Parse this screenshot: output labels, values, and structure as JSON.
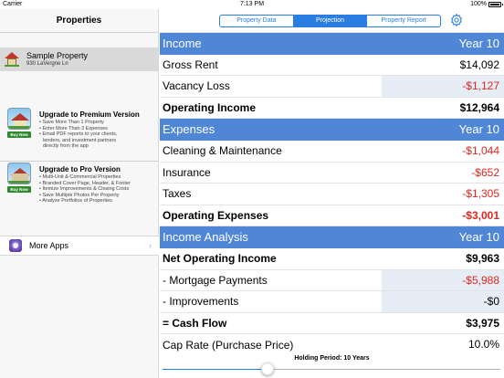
{
  "status_bar": {
    "carrier": "Carrier",
    "time": "7:13 PM",
    "battery": "100%"
  },
  "sidebar": {
    "title": "Properties",
    "property": {
      "name": "Sample Property",
      "address": "930 LaVergne Ln"
    },
    "promos": [
      {
        "title": "Upgrade to Premium Version",
        "button": "Buy Now",
        "bullets": [
          "• Save More Than 1 Property",
          "• Enter More Than 3 Expenses",
          "• Email PDF reports to your clients,",
          "  lenders, and investment partners",
          "  directly from the app"
        ]
      },
      {
        "title": "Upgrade to Pro Version",
        "button": "Buy Now",
        "bullets": [
          "• Multi-Unit & Commercial Properties",
          "• Branded Cover Page, Header, & Footer",
          "• Itemize Improvements & Closing Costs",
          "• Save Multiple Photos Per Property",
          "• Analyze Portfolios of Properties"
        ]
      }
    ],
    "more_apps": "More Apps"
  },
  "tabs": [
    {
      "label": "Property Data",
      "active": false
    },
    {
      "label": "Projection",
      "active": true
    },
    {
      "label": "Property Report",
      "active": false
    }
  ],
  "table": [
    {
      "kind": "section",
      "label": "Income",
      "value": "Year 10"
    },
    {
      "kind": "row",
      "label": "Gross Rent",
      "value": "$14,092",
      "negative": false,
      "bold": false
    },
    {
      "kind": "row",
      "label": "Vacancy Loss",
      "value": "-$1,127",
      "negative": true,
      "bold": false,
      "shaded": true
    },
    {
      "kind": "row",
      "label": "Operating Income",
      "value": "$12,964",
      "negative": false,
      "bold": true
    },
    {
      "kind": "section",
      "label": "Expenses",
      "value": "Year 10"
    },
    {
      "kind": "row",
      "label": "Cleaning & Maintenance",
      "value": "-$1,044",
      "negative": true,
      "bold": false
    },
    {
      "kind": "row",
      "label": "Insurance",
      "value": "-$652",
      "negative": true,
      "bold": false
    },
    {
      "kind": "row",
      "label": "Taxes",
      "value": "-$1,305",
      "negative": true,
      "bold": false
    },
    {
      "kind": "row",
      "label": "Operating Expenses",
      "value": "-$3,001",
      "negative": true,
      "bold": true
    },
    {
      "kind": "section",
      "label": "Income Analysis",
      "value": "Year 10"
    },
    {
      "kind": "row",
      "label": "Net Operating Income",
      "value": "$9,963",
      "negative": false,
      "bold": true
    },
    {
      "kind": "row",
      "label": "- Mortgage Payments",
      "value": "-$5,988",
      "negative": true,
      "bold": false,
      "shaded": true
    },
    {
      "kind": "row",
      "label": "- Improvements",
      "value": "-$0",
      "negative": false,
      "bold": false,
      "shaded": true
    },
    {
      "kind": "row",
      "label": "= Cash Flow",
      "value": "$3,975",
      "negative": false,
      "bold": true
    },
    {
      "kind": "row",
      "label": "Cap Rate (Purchase Price)",
      "value": "10.0%",
      "negative": false,
      "bold": false
    }
  ],
  "holding_period": {
    "label": "Holding Period: 10 Years",
    "slider_fraction": 0.31
  },
  "colors": {
    "accent": "#2a7de1",
    "section_header": "#4f86d6",
    "negative": "#e0261d"
  }
}
